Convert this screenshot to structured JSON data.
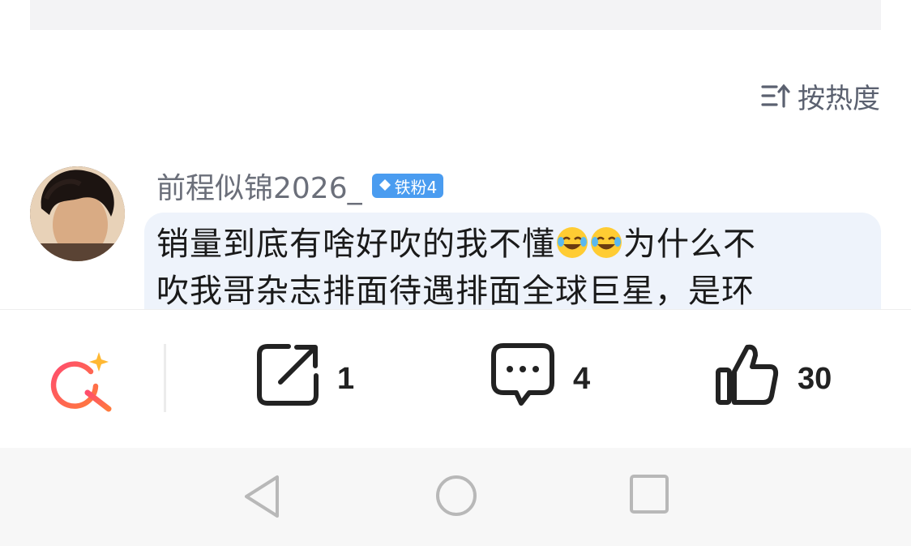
{
  "sort": {
    "label": "按热度"
  },
  "comment": {
    "username": "前程似锦2026_",
    "badge": "铁粉4",
    "line1_start": "销量到底有啥好吹的我不懂",
    "line1_end": "为什么不",
    "line2": "吹我哥杂志排面待遇排面全球巨星，是环"
  },
  "actions": {
    "share_count": "1",
    "comment_count": "4",
    "like_count": "30"
  },
  "colors": {
    "badge": "#4a9cf0",
    "bubble": "#eef3fb",
    "search_icon_gradient": [
      "#ff4d6d",
      "#ff7a3d"
    ]
  }
}
